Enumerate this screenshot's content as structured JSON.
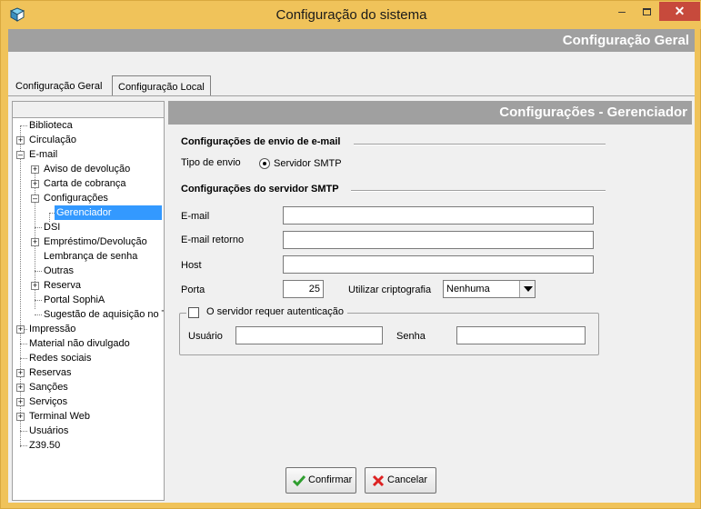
{
  "window": {
    "title": "Configuração do sistema"
  },
  "header": {
    "title": "Configuração Geral"
  },
  "tabs": [
    {
      "label": "Configuração Geral"
    },
    {
      "label": "Configuração Local"
    }
  ],
  "tree": {
    "items": [
      {
        "label": "Biblioteca"
      },
      {
        "label": "Circulação"
      },
      {
        "label": "E-mail"
      },
      {
        "label": "Aviso de devolução"
      },
      {
        "label": "Carta de cobrança"
      },
      {
        "label": "Configurações"
      },
      {
        "label": "Gerenciador"
      },
      {
        "label": "DSI"
      },
      {
        "label": "Empréstimo/Devolução"
      },
      {
        "label": "Lembrança de senha"
      },
      {
        "label": "Outras"
      },
      {
        "label": "Reserva"
      },
      {
        "label": "Portal SophiA"
      },
      {
        "label": "Sugestão de aquisição no T"
      },
      {
        "label": "Impressão"
      },
      {
        "label": "Material não divulgado"
      },
      {
        "label": "Redes sociais"
      },
      {
        "label": "Reservas"
      },
      {
        "label": "Sanções"
      },
      {
        "label": "Serviços"
      },
      {
        "label": "Terminal Web"
      },
      {
        "label": "Usuários"
      },
      {
        "label": "Z39.50"
      }
    ]
  },
  "panel": {
    "title": "Configurações - Gerenciador",
    "send_section": "Configurações de envio de e-mail",
    "send_type_label": "Tipo de envio",
    "send_type_value": "Servidor SMTP",
    "smtp_section": "Configurações do servidor SMTP",
    "email_label": "E-mail",
    "email_value": "",
    "reply_label": "E-mail retorno",
    "reply_value": "",
    "host_label": "Host",
    "host_value": "",
    "port_label": "Porta",
    "port_value": "25",
    "crypto_label": "Utilizar criptografia",
    "crypto_value": "Nenhuma",
    "auth_label": "O servidor requer autenticação",
    "user_label": "Usuário",
    "user_value": "",
    "password_label": "Senha",
    "password_value": ""
  },
  "buttons": {
    "confirm": "Confirmar",
    "cancel": "Cancelar"
  }
}
